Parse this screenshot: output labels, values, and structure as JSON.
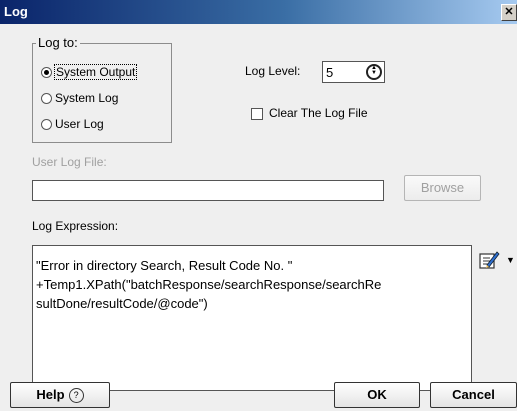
{
  "window": {
    "title": "Log",
    "close_glyph": "✕"
  },
  "log_to": {
    "legend": "Log to:",
    "options": [
      {
        "label": "System Output",
        "selected": true
      },
      {
        "label": "System Log",
        "selected": false
      },
      {
        "label": "User Log",
        "selected": false
      }
    ]
  },
  "log_level": {
    "label": "Log Level:",
    "value": "5"
  },
  "clear_log": {
    "label": "Clear The Log File",
    "checked": false
  },
  "user_log_file": {
    "label": "User Log File:",
    "value": "",
    "browse_label": "Browse"
  },
  "log_expression": {
    "label": "Log Expression:",
    "lines": [
      "\"Error in directory Search, Result Code No. \"",
      "+Temp1.XPath(\"batchResponse/searchResponse/searchRe",
      "sultDone/resultCode/@code\")"
    ]
  },
  "footer": {
    "help_label": "Help",
    "help_glyph": "?",
    "ok_label": "OK",
    "cancel_label": "Cancel"
  },
  "icons": {
    "edit": "edit-expression-icon",
    "dropdown": "chevron-down-icon"
  },
  "colors": {
    "titlebar_start": "#0a246a",
    "titlebar_end": "#a6caf0",
    "panel": "#efefef"
  }
}
